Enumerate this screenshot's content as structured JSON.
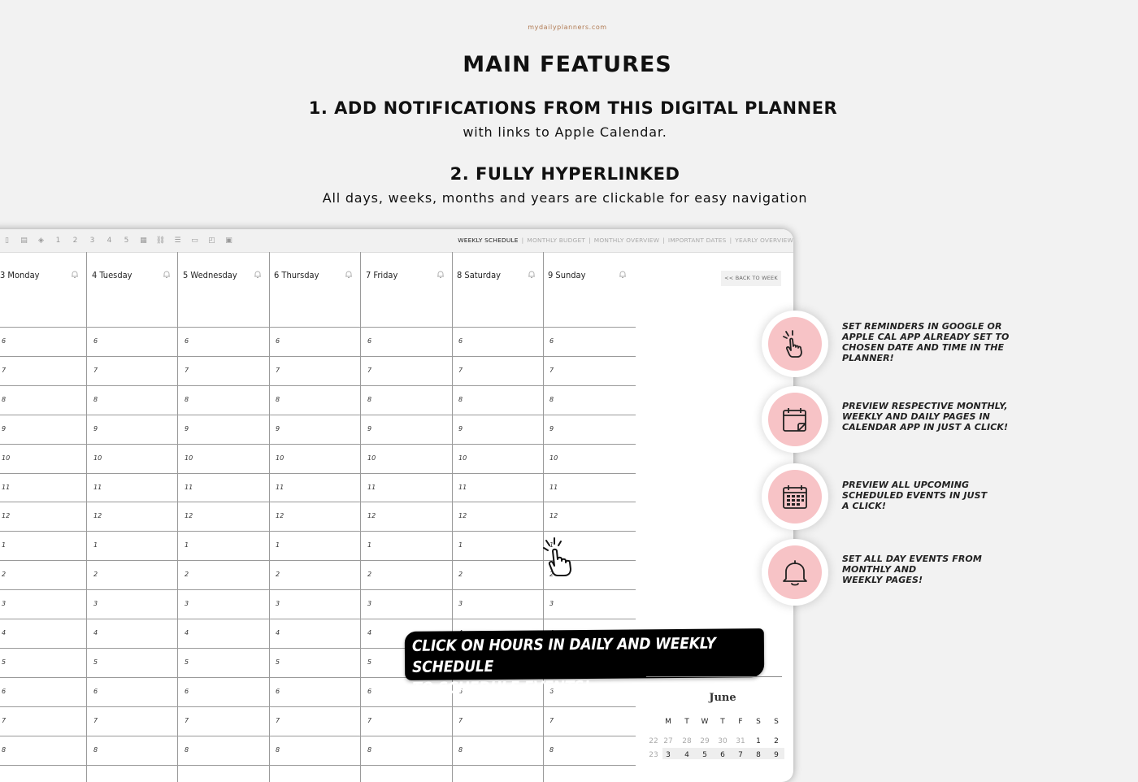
{
  "header": {
    "site": "mydailyplanners.com",
    "title": "MAIN FEATURES",
    "feature1_title": "1. ADD NOTIFICATIONS FROM THIS DIGITAL PLANNER",
    "feature1_sub": "with links to Apple Calendar.",
    "feature2_title": "2. FULLY HYPERLINKED",
    "feature2_sub": "All days, weeks, months and years are clickable for easy navigation"
  },
  "toolbar": {
    "icons": [
      "doc-icon",
      "notes-icon",
      "layers-icon",
      "1",
      "2",
      "3",
      "4",
      "5",
      "grid-icon",
      "link-icon",
      "list-icon",
      "book-icon",
      "sticky-icon",
      "table-icon"
    ],
    "tabs": [
      "WEEKLY SCHEDULE",
      "MONTHLY BUDGET",
      "MONTHLY OVERVIEW",
      "IMPORTANT DATES",
      "YEARLY OVERVIEW"
    ],
    "active_tab": "WEEKLY SCHEDULE"
  },
  "schedule": {
    "days": [
      "3 Monday",
      "4 Tuesday",
      "5 Wednesday",
      "6 Thursday",
      "7 Friday",
      "8 Saturday",
      "9 Sunday"
    ],
    "hours": [
      "6",
      "7",
      "8",
      "9",
      "10",
      "11",
      "12",
      "1",
      "2",
      "3",
      "4",
      "5",
      "6",
      "7",
      "8"
    ],
    "back_label": "<< BACK TO WEEK"
  },
  "features": [
    {
      "icon": "tap-hand-icon",
      "text": "SET REMINDERS IN GOOGLE OR\nAPPLE CAL APP ALREADY SET TO\nCHOSEN DATE AND TIME IN THE\nPLANNER!"
    },
    {
      "icon": "calendar-note-icon",
      "text": "PREVIEW RESPECTIVE MONTHLY,\nWEEKLY AND DAILY PAGES IN\nCALENDAR APP IN JUST A CLICK!"
    },
    {
      "icon": "calendar-grid-icon",
      "text": "PREVIEW ALL UPCOMING\nSCHEDULED  EVENTS IN JUST\nA CLICK!"
    },
    {
      "icon": "bell-icon",
      "text": "SET ALL DAY EVENTS FROM\nMONTHLY AND\nWEEKLY PAGES!"
    }
  ],
  "callout": "CLICK ON HOURS IN DAILY AND WEEKLY SCHEDULE\nTO SCHEDULE EVENTS!",
  "mini_calendar": {
    "month": "June",
    "weekdays": [
      "M",
      "T",
      "W",
      "T",
      "F",
      "S",
      "S"
    ],
    "row1": [
      "22",
      "27",
      "28",
      "29",
      "30",
      "31",
      "1",
      "2"
    ],
    "row2": [
      "23",
      "3",
      "4",
      "5",
      "6",
      "7",
      "8",
      "9"
    ]
  },
  "colors": {
    "accent_pink": "#f7c3c6",
    "background": "#f2f2f2",
    "site_link": "#b07a52"
  }
}
